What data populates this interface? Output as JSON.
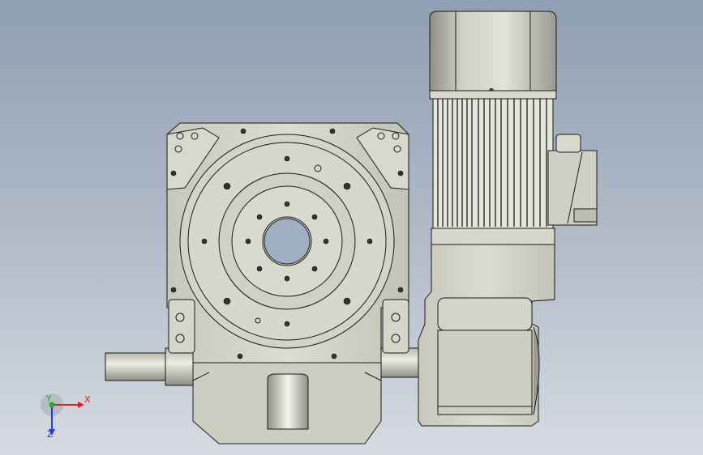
{
  "viewport": {
    "background_top": "#8f9fb4",
    "background_bottom": "#d6dbe2"
  },
  "model": {
    "body_color": "#d2d2c7",
    "shade_color": "#a9a99d",
    "outline_color": "#1a1a1a",
    "motor_fins_color": "#e8e8e0"
  },
  "triad": {
    "x_label": "X",
    "y_label": "Y",
    "z_label": "Z",
    "x_color": "#e02020",
    "y_color": "#20b020",
    "z_color": "#2a3bd0"
  }
}
